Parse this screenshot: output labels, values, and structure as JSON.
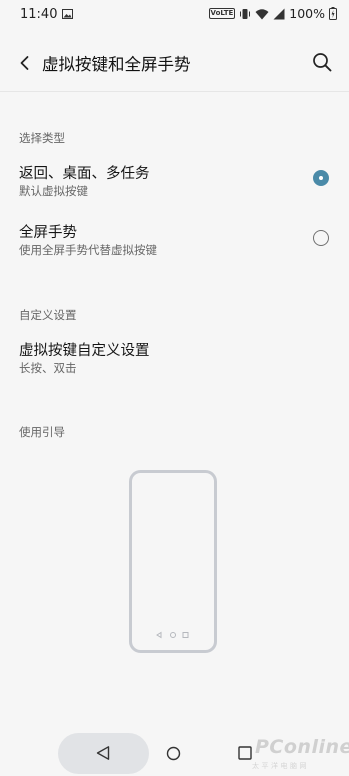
{
  "status_bar": {
    "time": "11:40",
    "volte": "VoLTE",
    "battery_percent": "100%"
  },
  "header": {
    "title": "虚拟按键和全屏手势"
  },
  "sections": {
    "type": {
      "header": "选择类型",
      "options": [
        {
          "title": "返回、桌面、多任务",
          "subtitle": "默认虚拟按键",
          "selected": true
        },
        {
          "title": "全屏手势",
          "subtitle": "使用全屏手势代替虚拟按键",
          "selected": false
        }
      ]
    },
    "custom": {
      "header": "自定义设置",
      "item": {
        "title": "虚拟按键自定义设置",
        "subtitle": "长按、双击"
      }
    },
    "guide": {
      "header": "使用引导"
    }
  },
  "watermark": {
    "brand": "PConline",
    "tagline": "太平洋电脑网"
  },
  "colors": {
    "accent": "#4a8aa8",
    "background": "#f6f6f6",
    "nav_pill": "#e1e3e6"
  },
  "icons": [
    "gallery-icon",
    "vibrate-icon",
    "wifi-icon",
    "signal-icon",
    "battery-icon",
    "back-arrow-icon",
    "search-icon",
    "nav-back-icon",
    "nav-home-icon",
    "nav-recents-icon"
  ]
}
